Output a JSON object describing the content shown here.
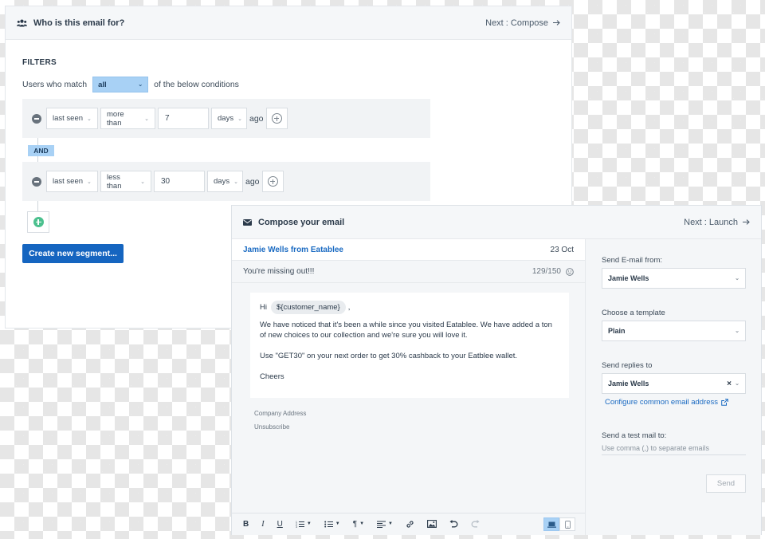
{
  "segment": {
    "header_title": "Who is this email for?",
    "next_label": "Next : Compose",
    "filters_label": "FILTERS",
    "match_prefix": "Users who match",
    "match_value": "all",
    "match_suffix": "of the below conditions",
    "conditions": [
      {
        "field": "last seen",
        "operator": "more than",
        "value": "7",
        "unit": "days",
        "suffix": "ago"
      },
      {
        "field": "last seen",
        "operator": "less than",
        "value": "30",
        "unit": "days",
        "suffix": "ago"
      }
    ],
    "connector": "AND",
    "create_button": "Create new segment..."
  },
  "compose": {
    "header_title": "Compose your email",
    "next_label": "Next : Launch",
    "sender": "Jamie Wells from Eatablee",
    "date": "23 Oct",
    "subject": "You're missing out!!!",
    "subject_count": "129/150",
    "body": {
      "greeting": "Hi",
      "token": "${customer_name}",
      "greeting_end": ",",
      "para1": "We have noticed that it's been a while since you visited Eatablee. We have added a ton of new choices to our collection and we're sure you will love it.",
      "para2": "Use \"GET30\" on your next order to get 30% cashback to your Eatblee wallet.",
      "sign_off": "Cheers"
    },
    "footer": {
      "company_address": "Company Address",
      "unsubscribe": "Unsubscribe"
    },
    "toolbar": {
      "bold": "B",
      "italic": "I",
      "underline": "U",
      "paragraph": "¶"
    }
  },
  "settings": {
    "send_from_label": "Send E-mail from:",
    "send_from_value": "Jamie Wells",
    "template_label": "Choose a template",
    "template_value": "Plain",
    "reply_label": "Send replies to",
    "reply_value": "Jamie Wells",
    "config_link": "Configure common email address",
    "test_label": "Send a test mail to:",
    "test_placeholder": "Use comma (,) to separate emails",
    "send_button": "Send"
  },
  "colors": {
    "primary": "#1565c0",
    "link": "#1a6ac2",
    "accent_light": "#a8d1f5",
    "add_green": "#4bc08e"
  }
}
